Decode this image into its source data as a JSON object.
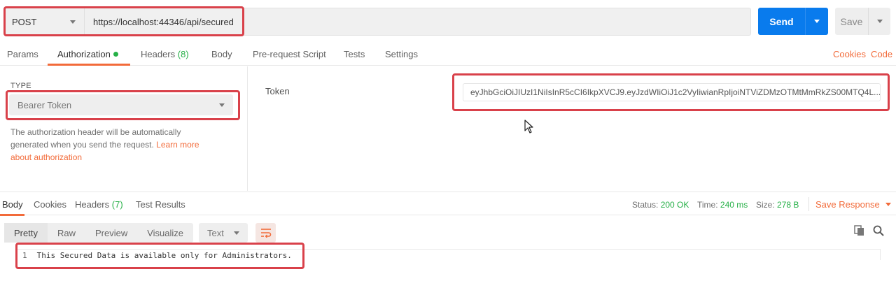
{
  "request": {
    "method": "POST",
    "url": "https://localhost:44346/api/secured",
    "send_label": "Send",
    "save_label": "Save"
  },
  "request_tabs": {
    "params": "Params",
    "authorization": "Authorization",
    "headers": "Headers",
    "headers_count": "(8)",
    "body": "Body",
    "pre_request": "Pre-request Script",
    "tests": "Tests",
    "settings": "Settings",
    "cookies": "Cookies",
    "code": "Code"
  },
  "auth": {
    "type_label": "TYPE",
    "type_value": "Bearer Token",
    "description": "The authorization header will be automatically generated when you send the request. ",
    "learn_more": "Learn more about authorization",
    "token_label": "Token",
    "token_value": "eyJhbGciOiJIUzI1NiIsInR5cCI6IkpXVCJ9.eyJzdWIiOiJ1c2VyIiwianRpIjoiNTViZDMzOTMtMmRkZS00MTQ4L..."
  },
  "response_tabs": {
    "body": "Body",
    "cookies": "Cookies",
    "headers": "Headers",
    "headers_count": "(7)",
    "test_results": "Test Results"
  },
  "response_status": {
    "status_label": "Status:",
    "status_value": "200 OK",
    "time_label": "Time:",
    "time_value": "240 ms",
    "size_label": "Size:",
    "size_value": "278 B",
    "save_response": "Save Response"
  },
  "response_view": {
    "pretty": "Pretty",
    "raw": "Raw",
    "preview": "Preview",
    "visualize": "Visualize",
    "format": "Text"
  },
  "response_body": {
    "line_number": "1",
    "line_text": "This Secured Data is available only for Administrators."
  },
  "colors": {
    "accent": "#f26b3a",
    "send": "#097bed",
    "success": "#26b047",
    "highlight": "#d9414a"
  }
}
